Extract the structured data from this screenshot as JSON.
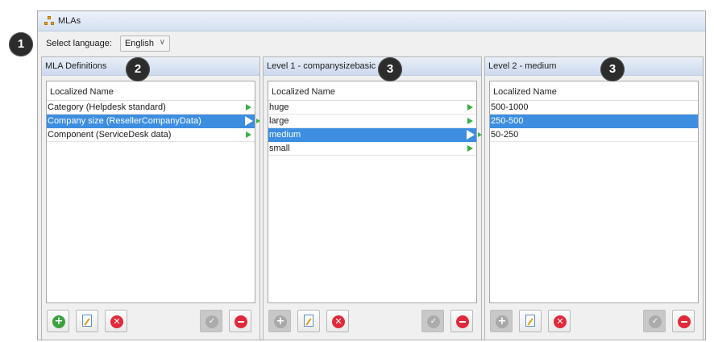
{
  "window": {
    "title": "MLAs"
  },
  "language": {
    "label": "Select language:",
    "value": "English"
  },
  "callouts": [
    "1",
    "2",
    "3",
    "3"
  ],
  "panels": [
    {
      "title": "MLA Definitions",
      "column": "Localized Name",
      "rows": [
        "Category (Helpdesk standard)",
        "Company size (ResellerCompanyData)",
        "Component (ServiceDesk data)"
      ]
    },
    {
      "title": "Level 1 - companysizebasic",
      "column": "Localized Name",
      "rows": [
        "huge",
        "large",
        "medium",
        "small"
      ]
    },
    {
      "title": "Level 2 - medium",
      "column": "Localized Name",
      "rows": [
        "500-1000",
        "250-500",
        "50-250"
      ]
    }
  ],
  "icons": {
    "add": "add-circle-icon",
    "edit": "edit-document-icon",
    "delete": "delete-x-icon",
    "apply": "checkmark-icon",
    "remove": "remove-minus-icon",
    "drill": "arrow-right-icon"
  },
  "colors": {
    "selection": "#3d8ee0",
    "accent_green": "#3aa33f",
    "accent_red": "#e2283b"
  }
}
